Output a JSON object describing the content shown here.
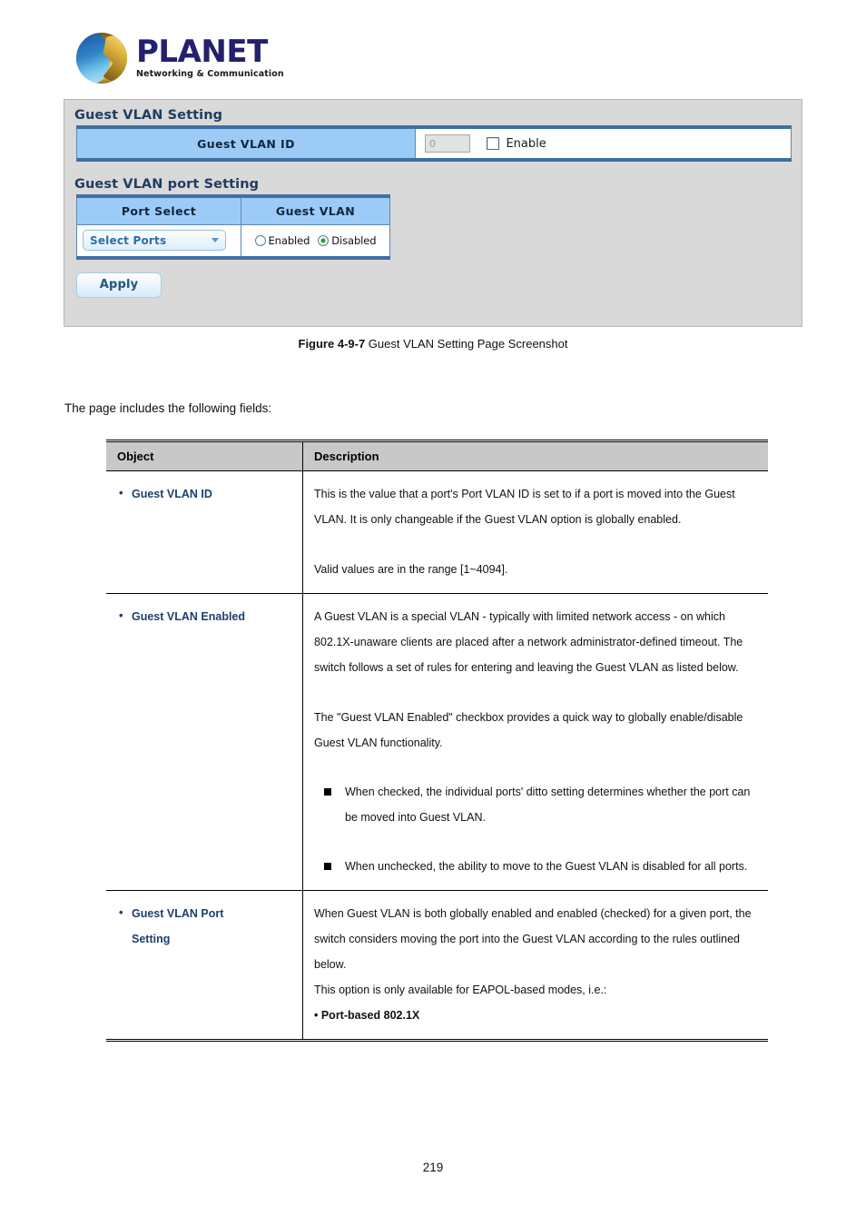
{
  "logo": {
    "brand": "PLANET",
    "tagline": "Networking & Communication"
  },
  "screenshot_panel": {
    "section1_heading": "Guest VLAN Setting",
    "guest_vlan_id": {
      "label": "Guest VLAN ID",
      "input_value": "0",
      "checkbox_label": "Enable",
      "checkbox_checked": "false"
    },
    "section2_heading": "Guest VLAN port Setting",
    "port_setting": {
      "col1_header": "Port Select",
      "col2_header": "Guest VLAN",
      "select_ports_value": "Select Ports",
      "radio_enabled_label": "Enabled",
      "radio_disabled_label": "Disabled",
      "radio_selected": "Disabled"
    },
    "apply_label": "Apply",
    "colors": {
      "panel_bg": "#d9d9d9",
      "table_band": "#3f6f9f",
      "header_cell": "#9ccbf7",
      "radio_on": "#1ea32a",
      "link_blue": "#2f6ea5"
    }
  },
  "figure": {
    "number": "Figure 4-9-7",
    "caption": " Guest VLAN Setting Page Screenshot"
  },
  "lead_text": "The page includes the following fields:",
  "desc_table": {
    "headers": {
      "object": "Object",
      "description": "Description"
    },
    "rows": [
      {
        "object": "Guest VLAN ID",
        "object_cont": "",
        "paragraphs": [
          "This is the value that a port's Port VLAN ID is set to if a port is moved into the Guest VLAN. It is only changeable if the Guest VLAN option is globally enabled.",
          "Valid values are in the range [1~4094]."
        ],
        "bullets": [],
        "tail": ""
      },
      {
        "object": "Guest VLAN Enabled",
        "object_cont": "",
        "paragraphs": [
          "A Guest VLAN is a special VLAN - typically with limited network access - on which 802.1X-unaware clients are placed after a network administrator-defined timeout. The switch follows a set of rules for entering and leaving the Guest VLAN as listed below.",
          "The \"Guest VLAN Enabled\" checkbox provides a quick way to globally enable/disable Guest VLAN functionality."
        ],
        "bullets": [
          "When checked, the individual ports' ditto setting determines whether the port can be moved into Guest VLAN.",
          "When unchecked, the ability to move to the Guest VLAN is disabled for all ports."
        ],
        "tail": ""
      },
      {
        "object": "Guest VLAN Port",
        "object_cont": "Setting",
        "paragraphs": [
          "When Guest VLAN is both globally enabled and enabled (checked) for a given port, the switch considers moving the port into the Guest VLAN according to the rules outlined below.",
          "This option is only available for EAPOL-based modes, i.e.:"
        ],
        "bullets": [],
        "tail": "• Port-based 802.1X"
      }
    ]
  },
  "page_number": "219"
}
